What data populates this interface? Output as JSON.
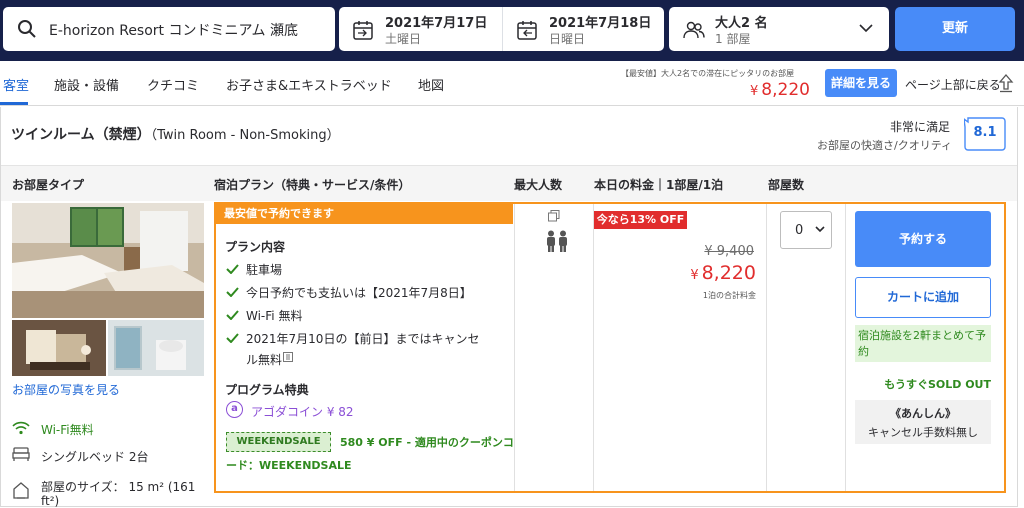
{
  "search": {
    "destination": "E-horizon Resort コンドミニアム 瀬底",
    "checkin_date": "2021年7月17日",
    "checkin_day": "土曜日",
    "checkout_date": "2021年7月18日",
    "checkout_day": "日曜日",
    "guests": "大人2 名",
    "rooms": "1 部屋",
    "update_label": "更新"
  },
  "nav": {
    "tabs": [
      "客室",
      "施設・設備",
      "クチコミ",
      "お子さま&エキストラベッド",
      "地図"
    ],
    "lowest_note": "【最安値】大人2名での滞在にピッタリのお部屋",
    "price_symbol": "¥",
    "price": "8,220",
    "details_label": "詳細を見る",
    "back_to_top": "ページ上部に戻る"
  },
  "room": {
    "title": "ツインルーム（禁煙）",
    "title_en": "（Twin Room - Non-Smoking）",
    "satisfaction": "非常に満足",
    "satisfaction_sub": "お部屋の快適さ/クオリティ",
    "score": "8.1",
    "headers": {
      "room_type": "お部屋タイプ",
      "plan": "宿泊プラン（特典・サービス/条件）",
      "max_guests": "最大人数",
      "price": "本日の料金｜1部屋/1泊",
      "rooms": "部屋数"
    },
    "photos_link": "お部屋の写真を見る",
    "amenities": [
      {
        "icon": "wifi-icon",
        "label": "Wi-Fi無料"
      },
      {
        "icon": "bed-icon",
        "label": "シングルベッド 2台"
      },
      {
        "icon": "house-icon",
        "label": "部屋のサイズ： 15 m² (161",
        "label2": "ft²)"
      }
    ]
  },
  "plan": {
    "banner": "最安値で予約できます",
    "content_heading": "プラン内容",
    "benefits": [
      "駐車場",
      "今日予約でも支払いは【2021年7月8日】",
      "Wi-Fi 無料",
      "2021年7月10日の【前日】まではキャンセ",
      "ル無料"
    ],
    "program_heading": "プログラム特典",
    "agoda_coin": "アゴダコイン ¥ 82",
    "coupon_code": "WEEKENDSALE",
    "coupon_line1": "580 ¥ OFF - 適用中のクーポンコ",
    "coupon_line2": "ード：WEEKENDSALE"
  },
  "pricing": {
    "discount_badge": "今なら13% OFF",
    "original": "¥ 9,400",
    "price_symbol": "¥",
    "price": "8,220",
    "note": "1泊の合計料金"
  },
  "booking": {
    "quantity": "0",
    "reserve_label": "予約する",
    "cart_label": "カートに追加",
    "multi_note": "宿泊施設を2軒まとめて予約",
    "soldout": "もうすぐSOLD OUT",
    "cancel_title": "《あんしん》",
    "cancel_sub": "キャンセル手数料無し"
  },
  "colors": {
    "topbar": "#16204a",
    "accent": "#488bf8",
    "price_red": "#e12d2d",
    "plan_orange": "#f7941d",
    "green": "#2f8a1f",
    "agoda_purple": "#8b4fd6"
  }
}
